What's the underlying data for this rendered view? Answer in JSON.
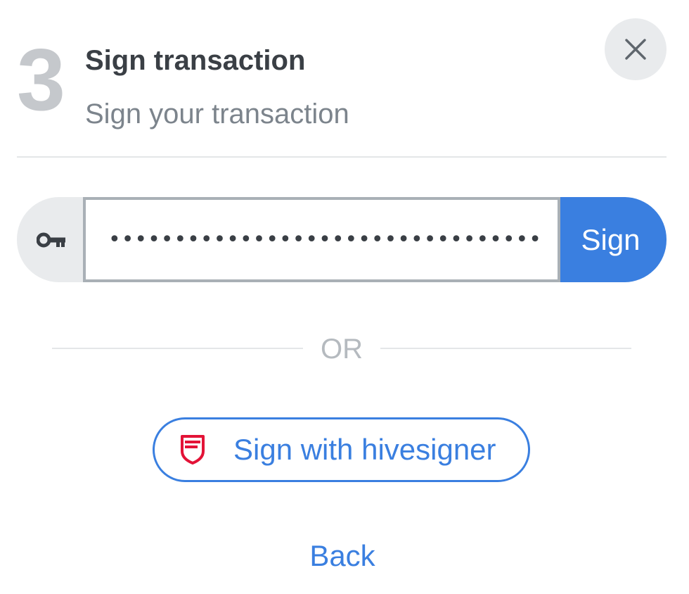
{
  "header": {
    "step_number": "3",
    "title": "Sign transaction",
    "subtitle": "Sign your transaction",
    "close_icon": "close-icon"
  },
  "key_form": {
    "prefix_icon": "key-icon",
    "input_value": "••••••••••••••••••••••••••••••••••••••••••••",
    "sign_label": "Sign"
  },
  "separator": {
    "or_label": "OR"
  },
  "hivesigner": {
    "icon": "hivesigner-logo-icon",
    "label": "Sign with hivesigner"
  },
  "footer": {
    "back_label": "Back"
  },
  "colors": {
    "accent": "#3a7fe0",
    "hivesigner_red": "#e31337",
    "muted_bg": "#e9ebed"
  }
}
